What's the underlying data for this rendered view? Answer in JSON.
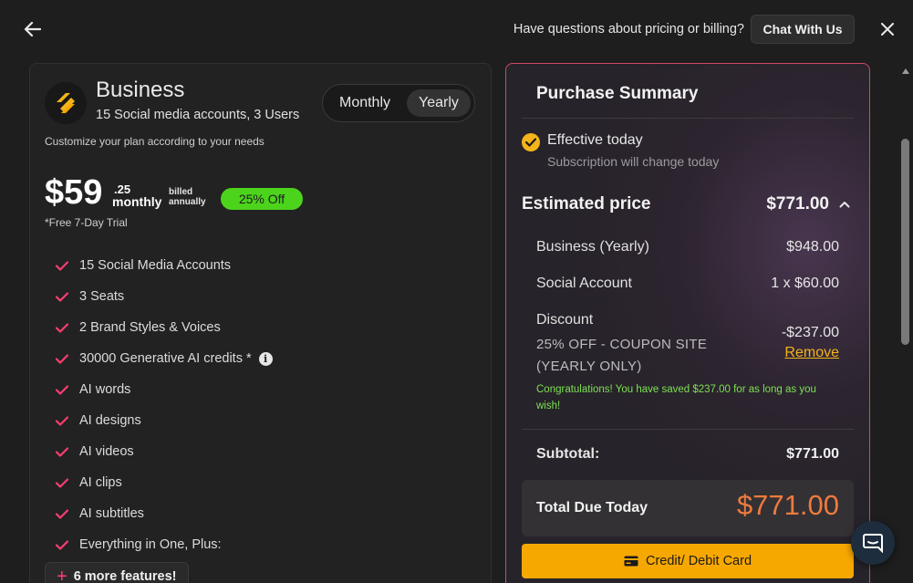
{
  "header": {
    "help_text": "Have questions about pricing or billing?",
    "chat_label": "Chat With Us"
  },
  "plan": {
    "name": "Business",
    "subtitle": "15 Social media accounts, 3 Users",
    "customize": "Customize your plan according to your needs",
    "billing_toggle": {
      "monthly": "Monthly",
      "yearly": "Yearly",
      "selected": "Yearly"
    },
    "price_main": "$59",
    "price_cents": ".25",
    "price_period": "monthly",
    "billed_line1": "billed",
    "billed_line2": "annually",
    "discount_badge": "25% Off",
    "trial": "*Free 7-Day Trial",
    "features": [
      "15 Social Media Accounts",
      "3 Seats",
      "2 Brand Styles & Voices",
      "30000 Generative AI credits *",
      "AI words",
      "AI designs",
      "AI videos",
      "AI clips",
      "AI subtitles",
      "Everything in One, Plus:"
    ],
    "more_features": "6 more features!"
  },
  "summary": {
    "title": "Purchase Summary",
    "effective_title": "Effective today",
    "effective_sub": "Subscription will change today",
    "estimated_label": "Estimated price",
    "estimated_value": "$771.00",
    "lines": [
      {
        "label": "Business (Yearly)",
        "value": "$948.00"
      },
      {
        "label": "Social Account",
        "value": "1 x $60.00"
      }
    ],
    "discount_label": "Discount",
    "discount_value": "-$237.00",
    "discount_detail_1": "25% OFF - COUPON SITE",
    "discount_detail_2": "(YEARLY ONLY)",
    "remove_label": "Remove",
    "congrats": "Congratulations! You have saved $237.00 for as long as you wish!",
    "subtotal_label": "Subtotal:",
    "subtotal_value": "$771.00",
    "total_label": "Total Due Today",
    "total_value": "$771.00",
    "pay_label": "Credit/ Debit Card"
  },
  "colors": {
    "accent_pink": "#ff3d72",
    "accent_yellow": "#f4b41a",
    "badge_green": "#4cd41c",
    "total_orange": "#f07a3e"
  }
}
